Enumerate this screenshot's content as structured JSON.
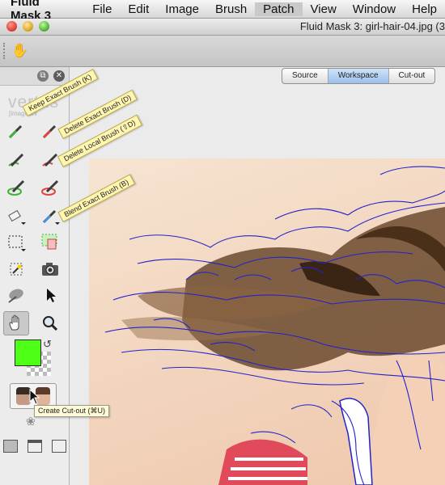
{
  "menubar": {
    "app": "Fluid Mask 3",
    "items": [
      "File",
      "Edit",
      "Image",
      "Brush",
      "Patch",
      "View",
      "Window",
      "Help"
    ],
    "active_item": "Patch"
  },
  "window": {
    "title": "Fluid Mask 3: girl-hair-04.jpg (3"
  },
  "panel": {
    "logo": "vertus",
    "logo_sub": "[image thi",
    "foreground_color": "#4dff14"
  },
  "tabs": [
    "Source",
    "Workspace",
    "Cut-out"
  ],
  "active_tab": "Workspace",
  "tooltips": {
    "keep_exact": "Keep Exact Brush (K)",
    "delete_exact": "Delete Exact Brush (D)",
    "delete_local": "Delete Local Brush (⇧D)",
    "blend_exact": "Blend Exact Brush (B)",
    "create_cutout": "Create Cut-out (⌘U)"
  },
  "icons": {
    "toolbar_hand": "hand-icon",
    "keep_brush": "green-brush-icon",
    "delete_brush": "red-brush-icon",
    "eraser": "eraser-icon",
    "blue_brush": "blue-brush-icon",
    "selection": "marquee-icon",
    "patch": "patch-icon",
    "magic": "magic-icon",
    "camera": "camera-icon",
    "blob": "blob-icon",
    "arrow": "arrow-icon",
    "hand": "hand-icon",
    "zoom": "zoom-icon"
  }
}
